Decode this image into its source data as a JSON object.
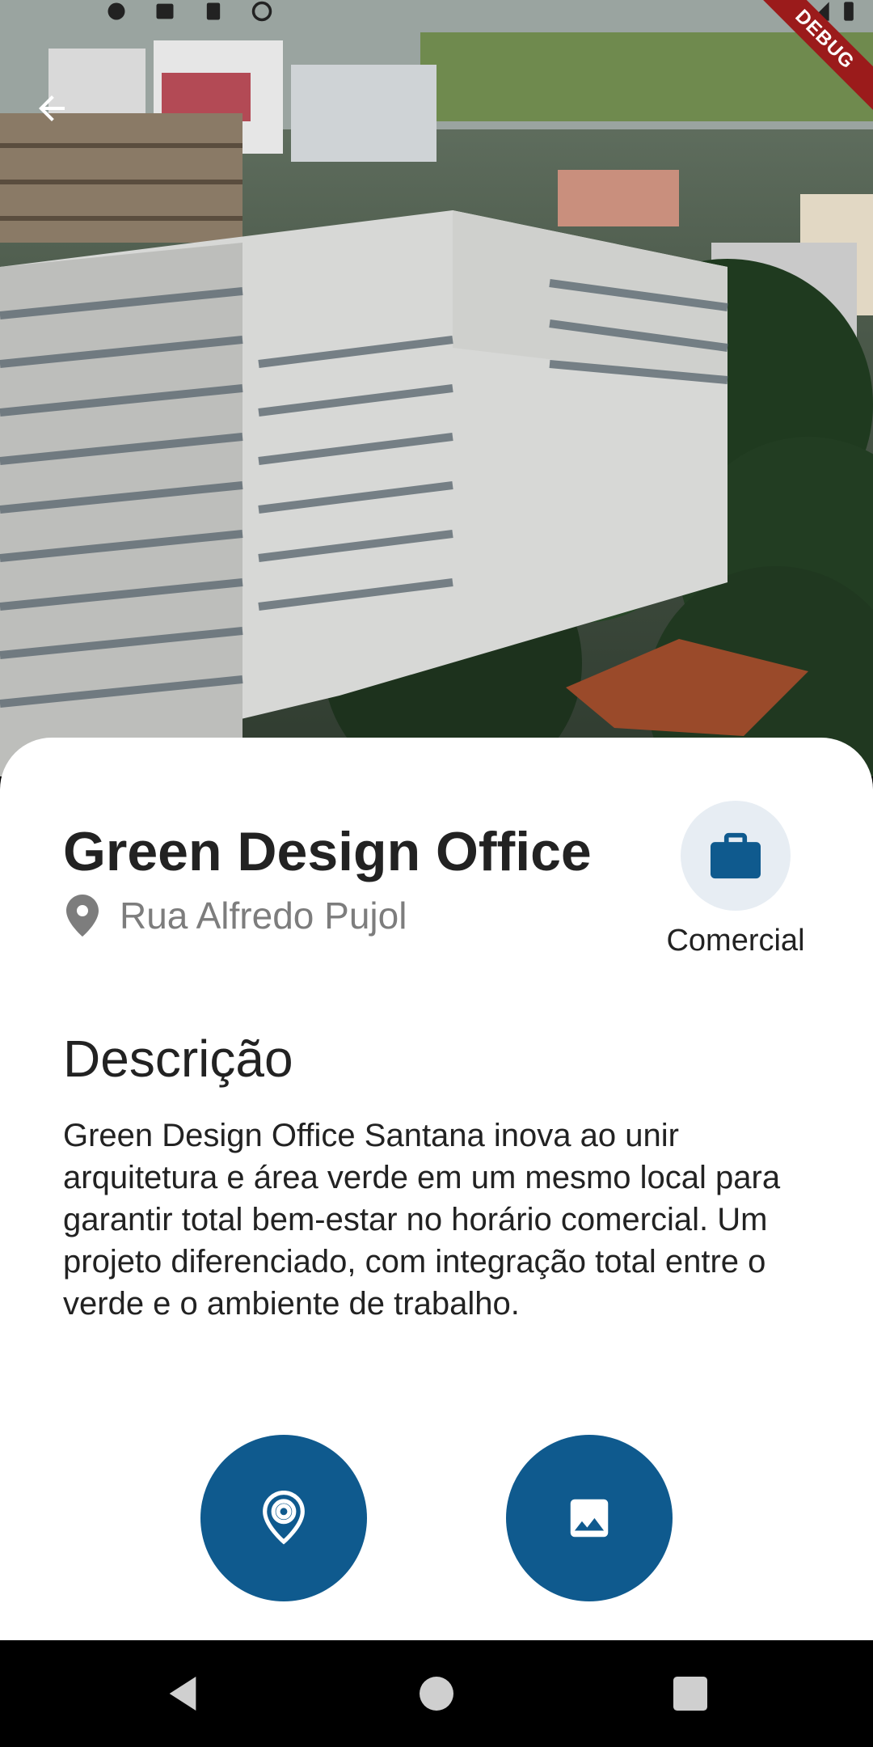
{
  "debug_banner": "DEBUG",
  "property": {
    "title": "Green Design Office",
    "address": "Rua Alfredo Pujol",
    "category": "Comercial",
    "category_icon": "briefcase-icon"
  },
  "description": {
    "heading": "Descrição",
    "text": "Green Design Office Santana inova ao unir arquitetura e área verde em um mesmo local para garantir total bem-estar no horário comercial. Um projeto diferenciado, com integração total entre o verde e o ambiente de trabalho."
  },
  "actions": [
    {
      "name": "map-location",
      "icon": "location-pin-icon"
    },
    {
      "name": "gallery",
      "icon": "image-icon"
    }
  ],
  "colors": {
    "accent": "#0f5a8e",
    "category_bg": "#e7edf3",
    "text": "#222222",
    "muted": "#7d7d7d",
    "debug": "#9b1b1b"
  }
}
